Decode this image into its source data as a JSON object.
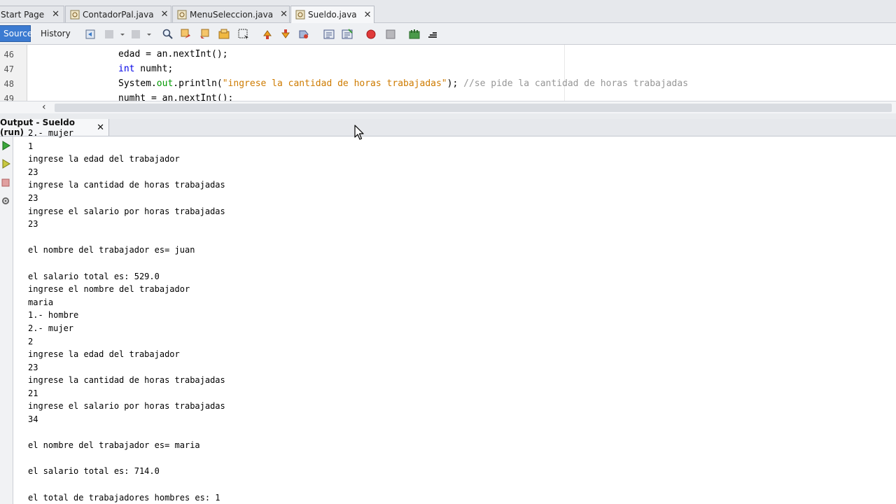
{
  "tabs": [
    {
      "label": "Start Page",
      "active": false
    },
    {
      "label": "ContadorPal.java",
      "active": false
    },
    {
      "label": "MenuSeleccion.java",
      "active": false
    },
    {
      "label": "Sueldo.java",
      "active": true
    }
  ],
  "toolbar": {
    "source_label": "Source",
    "history_label": "History"
  },
  "editor": {
    "lines": [
      {
        "num": "46"
      },
      {
        "num": "47"
      },
      {
        "num": "48"
      },
      {
        "num": "49"
      }
    ],
    "code46": "edad = an.nextInt();",
    "code47_kw": "int",
    "code47_rest": " numht;",
    "code48_a": "System.",
    "code48_out": "out",
    "code48_b": ".println(",
    "code48_str": "\"ingrese la cantidad de horas trabajadas\"",
    "code48_c": "); ",
    "code48_cmt": "//se pide la cantidad de horas trabajadas",
    "code49": "numht = an.nextInt();"
  },
  "output": {
    "tab_label": "Output - Sueldo (run)",
    "lines": [
      "2.- mujer",
      "1",
      "ingrese la edad del trabajador",
      "23",
      "ingrese la cantidad de horas trabajadas",
      "23",
      "ingrese el salario por horas trabajadas",
      "23",
      "",
      "el nombre del trabajador es= juan",
      "",
      "el salario total es: 529.0",
      "ingrese el nombre del trabajador",
      "maria",
      "1.- hombre",
      "2.- mujer",
      "2",
      "ingrese la edad del trabajador",
      "23",
      "ingrese la cantidad de horas trabajadas",
      "21",
      "ingrese el salario por horas trabajadas",
      "34",
      "",
      "el nombre del trabajador es= maria",
      "",
      "el salario total es: 714.0",
      "",
      "el total de trabajadores hombres es: 1"
    ]
  },
  "colors": {
    "accent": "#3c7bd1",
    "keyword": "#0000e6",
    "string": "#ce7b00",
    "comment": "#969696"
  }
}
